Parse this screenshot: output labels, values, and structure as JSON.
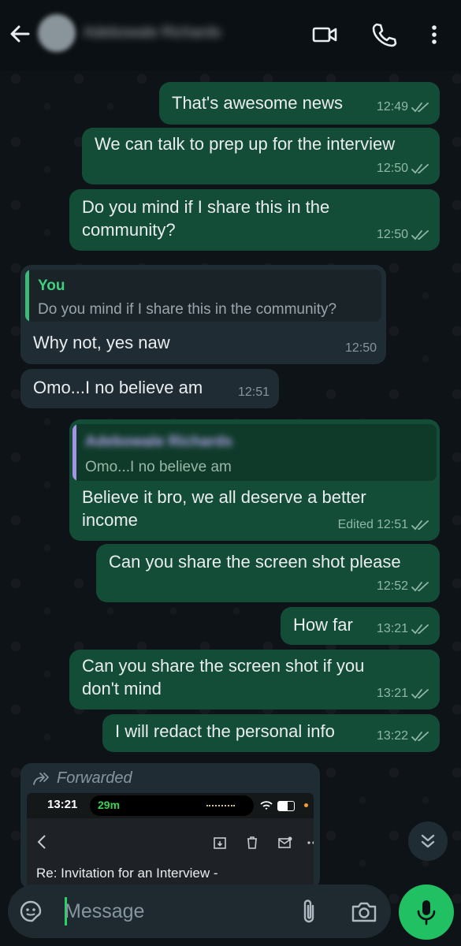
{
  "header": {
    "contact_name": "Adebowale Richards",
    "icons": [
      "back-arrow-icon",
      "video-call-icon",
      "voice-call-icon",
      "more-options-icon"
    ]
  },
  "colors": {
    "outgoing_bubble": "#144d37",
    "incoming_bubble": "#202c33",
    "accent_green": "#21c063",
    "read_ticks": "#8fb9a6",
    "quote_you": "#53bdeb",
    "quote_contact": "#a594e6"
  },
  "messages": [
    {
      "direction": "out",
      "text": "That's awesome news",
      "time": "12:49",
      "status": "read"
    },
    {
      "direction": "out",
      "text": "We can talk to prep up for the interview",
      "time": "12:50",
      "status": "read"
    },
    {
      "direction": "out",
      "lines": [
        "Do you mind if I share this in the",
        "community?"
      ],
      "time": "12:50",
      "status": "read"
    },
    {
      "direction": "in",
      "quote": {
        "name": "You",
        "text": "Do you mind if I share this in the community?"
      },
      "text": "Why not, yes naw",
      "time": "12:50"
    },
    {
      "direction": "in",
      "text": "Omo...I no believe am",
      "time": "12:51"
    },
    {
      "direction": "out",
      "quote": {
        "name": "Adebowale Richards",
        "text": "Omo...I no believe am"
      },
      "lines": [
        "Believe it bro, we all deserve a better",
        "income"
      ],
      "edited_label": "Edited",
      "time": "12:51",
      "status": "read"
    },
    {
      "direction": "out",
      "text": "Can you share the screen shot please",
      "time": "12:52",
      "status": "read"
    },
    {
      "direction": "out",
      "text": "How far",
      "time": "13:21",
      "status": "read"
    },
    {
      "direction": "out",
      "lines": [
        "Can you share the screen shot if you",
        "don't mind"
      ],
      "time": "13:21",
      "status": "read"
    },
    {
      "direction": "out",
      "text": "I will redact the personal info",
      "time": "13:22",
      "status": "read"
    }
  ],
  "forwarded": {
    "label": "Forwarded",
    "screenshot": {
      "time": "13:21",
      "call_duration": "29m",
      "subject": "Re: Invitation for an Interview -"
    }
  },
  "composer": {
    "placeholder": "Message",
    "icons": [
      "sticker-icon",
      "attach-icon",
      "camera-icon",
      "mic-icon"
    ]
  }
}
